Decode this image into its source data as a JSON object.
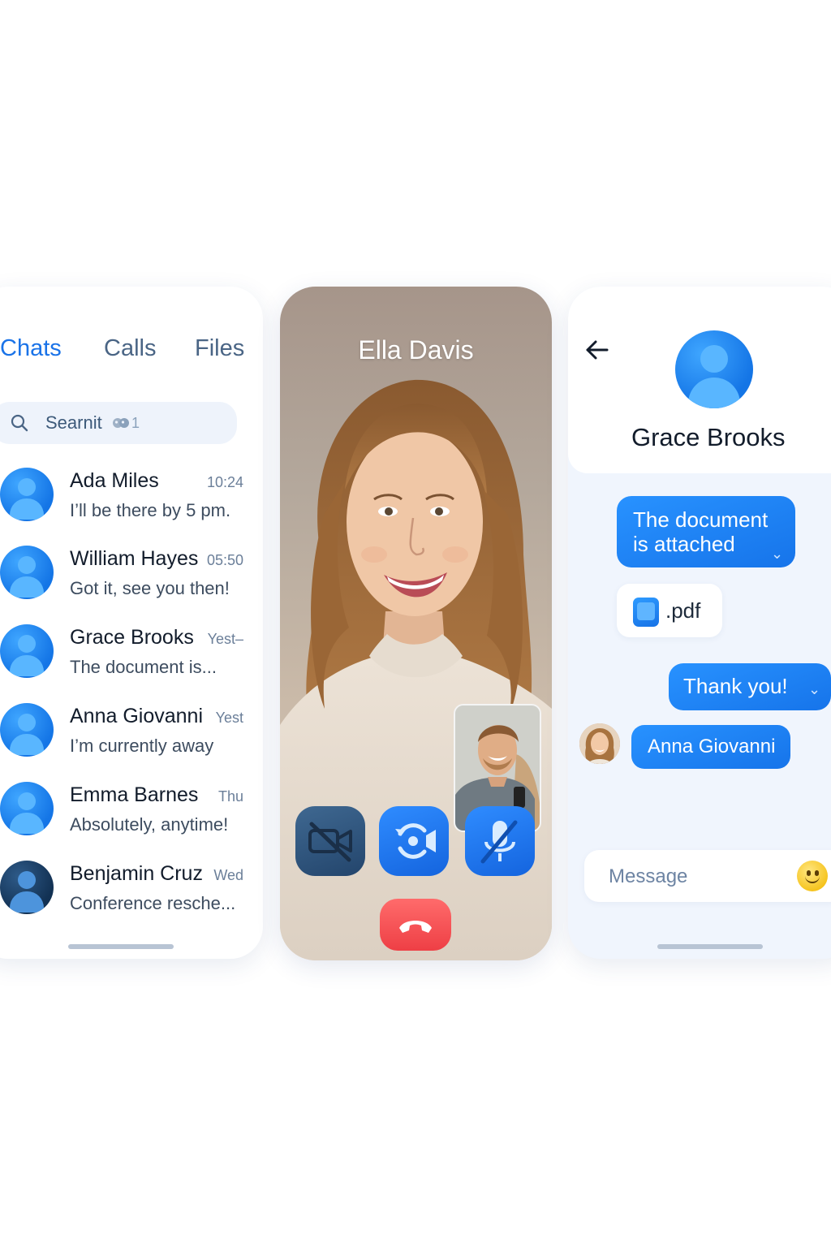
{
  "chat_list": {
    "tabs": [
      {
        "label": "Chats",
        "active": true
      },
      {
        "label": "Calls",
        "active": false
      },
      {
        "label": "Files",
        "active": false
      }
    ],
    "search": {
      "placeholder": "Searnit",
      "count": "1",
      "badge_icon": "people-icon"
    },
    "items": [
      {
        "name": "Ada Miles",
        "time": "10:24",
        "preview": "I’ll be there by 5 pm."
      },
      {
        "name": "William Hayes",
        "time": "05:50",
        "preview": "Got it, see you then!"
      },
      {
        "name": "Grace Brooks",
        "time": "Yest–",
        "preview": "The document is..."
      },
      {
        "name": "Anna Giovanni",
        "time": "Yest",
        "preview": "I’m currently away"
      },
      {
        "name": "Emma Barnes",
        "time": "Thu",
        "preview": "Absolutely, anytime!"
      },
      {
        "name": "Benjamin Cruz",
        "time": "Wed",
        "preview": "Conference resche..."
      }
    ]
  },
  "video_call": {
    "caller_name": "Ella Davis",
    "controls": [
      "video-off-icon",
      "switch-camera-icon",
      "mic-off-icon",
      "end-call-icon"
    ]
  },
  "conversation": {
    "contact_name": "Grace Brooks",
    "messages": [
      {
        "type": "text",
        "text": "The document is attached"
      },
      {
        "type": "file",
        "text": ".pdf"
      },
      {
        "type": "text",
        "text": "Thank you!"
      },
      {
        "type": "sender",
        "text": "Anna Giovanni"
      }
    ],
    "input_placeholder": "Message"
  },
  "colors": {
    "accent": "#1a73e8",
    "bubble": "#1674ea",
    "end_call": "#ee3f45",
    "panel_bg": "#f0f5fd"
  }
}
